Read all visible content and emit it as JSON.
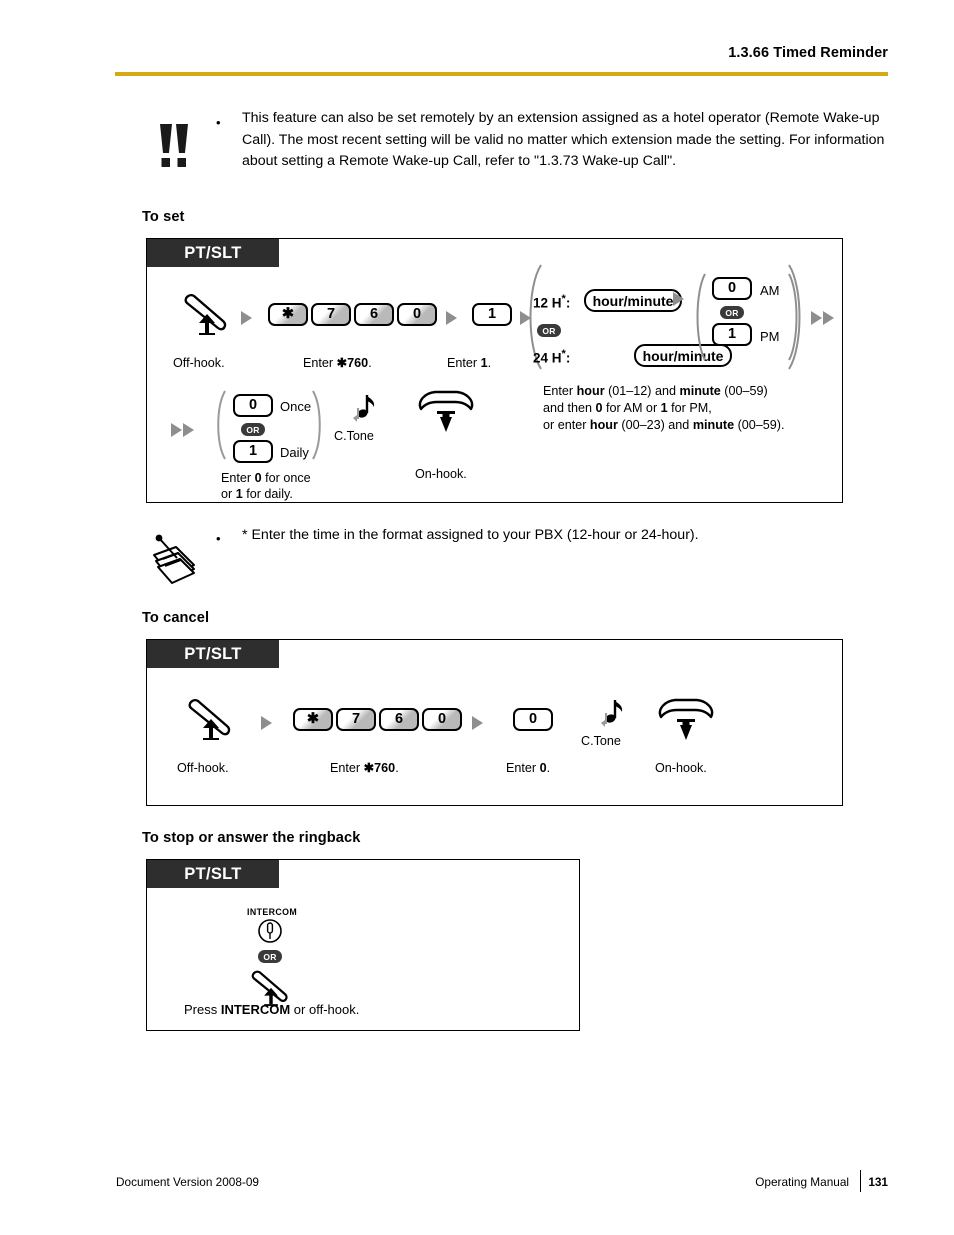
{
  "header": {
    "section_title": "1.3.66 Timed Reminder",
    "rule_color": "#d4ab12"
  },
  "notice": {
    "icon": "warning-double-exclamation-icon",
    "bullet": "•",
    "text": "This feature can also be set remotely by an extension assigned as a hotel operator (Remote Wake-up Call). The most recent setting will be valid no matter which extension made the setting. For information about setting a Remote Wake-up Call, refer to \"1.3.73  Wake-up Call\"."
  },
  "note": {
    "icon": "notepad-pencil-icon",
    "bullet": "•",
    "text": "* Enter the time in the format assigned to your PBX (12-hour or 24-hour)."
  },
  "sections": [
    {
      "heading": "To set",
      "phone_type": "PT/SLT",
      "steps": {
        "offhook_label": "Off-hook.",
        "code_keys": [
          "✱",
          "7",
          "6",
          "0"
        ],
        "code_caption_prefix": "Enter ",
        "code_caption_code": "✱760",
        "code_caption_suffix": ".",
        "one_key": "1",
        "one_caption_prefix": "Enter ",
        "one_caption_value": "1",
        "one_caption_suffix": ".",
        "fmt12_label": "12 H",
        "fmt12_star": "*",
        "fmt12_colon": ":",
        "fmt24_label": "24 H",
        "fmt24_star": "*",
        "fmt24_colon": ":",
        "hour_minute_label": "hour/minute",
        "or_badge": "OR",
        "ampm_am_key": "0",
        "ampm_am_label": "AM",
        "ampm_pm_key": "1",
        "ampm_pm_label": "PM",
        "explain_line1_a": "Enter ",
        "explain_line1_b": "hour",
        "explain_line1_c": " (01–12) and ",
        "explain_line1_d": "minute",
        "explain_line1_e": " (00–59)",
        "explain_line2_a": "and then ",
        "explain_line2_b": "0",
        "explain_line2_c": " for AM or ",
        "explain_line2_d": "1",
        "explain_line2_e": " for PM,",
        "explain_line3_a": "or enter ",
        "explain_line3_b": "hour",
        "explain_line3_c": " (00–23) and ",
        "explain_line3_d": "minute",
        "explain_line3_e": " (00–59).",
        "once_key": "0",
        "once_label": "Once",
        "daily_key": "1",
        "daily_label": "Daily",
        "onceday_caption_l1_a": "Enter ",
        "onceday_caption_l1_b": "0",
        "onceday_caption_l1_c": " for once",
        "onceday_caption_l2_a": "or ",
        "onceday_caption_l2_b": "1",
        "onceday_caption_l2_c": " for daily.",
        "ctone_label": "C.Tone",
        "onhook_label": "On-hook."
      }
    },
    {
      "heading": "To cancel",
      "phone_type": "PT/SLT",
      "steps": {
        "offhook_label": "Off-hook.",
        "code_keys": [
          "✱",
          "7",
          "6",
          "0"
        ],
        "code_caption_prefix": "Enter  ",
        "code_caption_code": "✱760",
        "code_caption_suffix": ".",
        "zero_key": "0",
        "zero_caption_prefix": "Enter ",
        "zero_caption_value": "0",
        "zero_caption_suffix": ".",
        "ctone_label": "C.Tone",
        "onhook_label": "On-hook."
      }
    },
    {
      "heading": "To stop or answer the ringback",
      "phone_type": "PT/SLT",
      "steps": {
        "intercom_label": "INTERCOM",
        "or_badge": "OR",
        "caption_a": "Press ",
        "caption_b": "INTERCOM",
        "caption_c": " or off-hook."
      }
    }
  ],
  "footer": {
    "left": "Document Version  2008-09",
    "manual": "Operating Manual",
    "page_number": "131"
  }
}
